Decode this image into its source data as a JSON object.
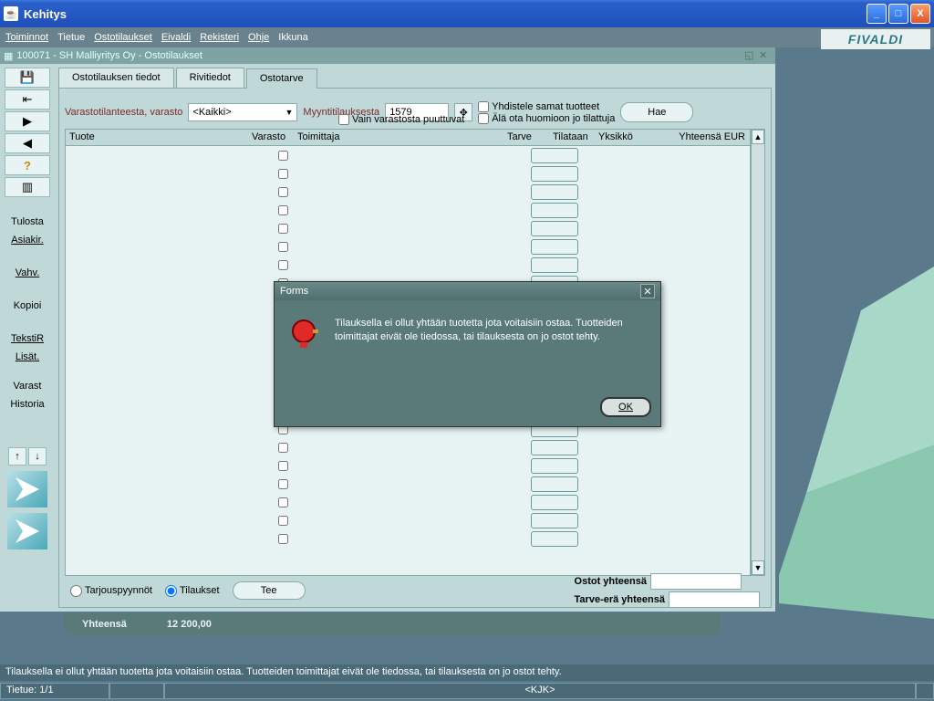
{
  "window": {
    "title": "Kehitys"
  },
  "menu": {
    "items": [
      "Toiminnot",
      "Tietue",
      "Ostotilaukset",
      "Eivaldi",
      "Rekisteri",
      "Ohje",
      "Ikkuna"
    ]
  },
  "logo": "FIVALDI",
  "mdi": {
    "title": "100071 - SH Malliyritys Oy - Ostotilaukset"
  },
  "sidebar": {
    "text_buttons": [
      "Tulosta",
      "Asiakir.",
      "Vahv.",
      "Kopioi",
      "TekstiR",
      "Lisät.",
      "Varast",
      "Historia"
    ]
  },
  "tabs": {
    "items": [
      "Ostotilauksen tiedot",
      "Rivitiedot",
      "Ostotarve"
    ],
    "active": 2
  },
  "filters": {
    "varasto_label": "Varastotilanteesta, varasto",
    "varasto_value": "<Kaikki>",
    "myynti_label": "Myyntitilauksesta",
    "myynti_value": "1579",
    "chk1": "Vain varastosta puuttuvat",
    "chk2": "Yhdistele samat tuotteet",
    "chk3": "Älä ota huomioon jo tilattuja",
    "hae": "Hae"
  },
  "table": {
    "headers": [
      "Tuote",
      "Varasto",
      "Toimittaja",
      "Tarve",
      "Tilataan",
      "Yksikkö",
      "Yhteensä EUR"
    ]
  },
  "bottom": {
    "radio1": "Tarjouspyynnöt",
    "radio2": "Tilaukset",
    "tee": "Tee",
    "total1_label": "Ostot yhteensä",
    "total2_label": "Tarve-erä yhteensä"
  },
  "summary": {
    "label": "Yhteensä",
    "value": "12 200,00"
  },
  "modal": {
    "title": "Forms",
    "message": "Tilauksella ei ollut yhtään tuotetta jota voitaisiin ostaa. Tuotteiden toimittajat eivät ole tiedossa, tai tilauksesta on jo ostot tehty.",
    "ok": "OK"
  },
  "status": {
    "line1": "Tilauksella ei ollut yhtään tuotetta jota voitaisiin ostaa. Tuotteiden toimittajat eivät ole tiedossa, tai tilauksesta on jo ostot tehty.",
    "record": "Tietue: 1/1",
    "user": "<KJK>"
  }
}
